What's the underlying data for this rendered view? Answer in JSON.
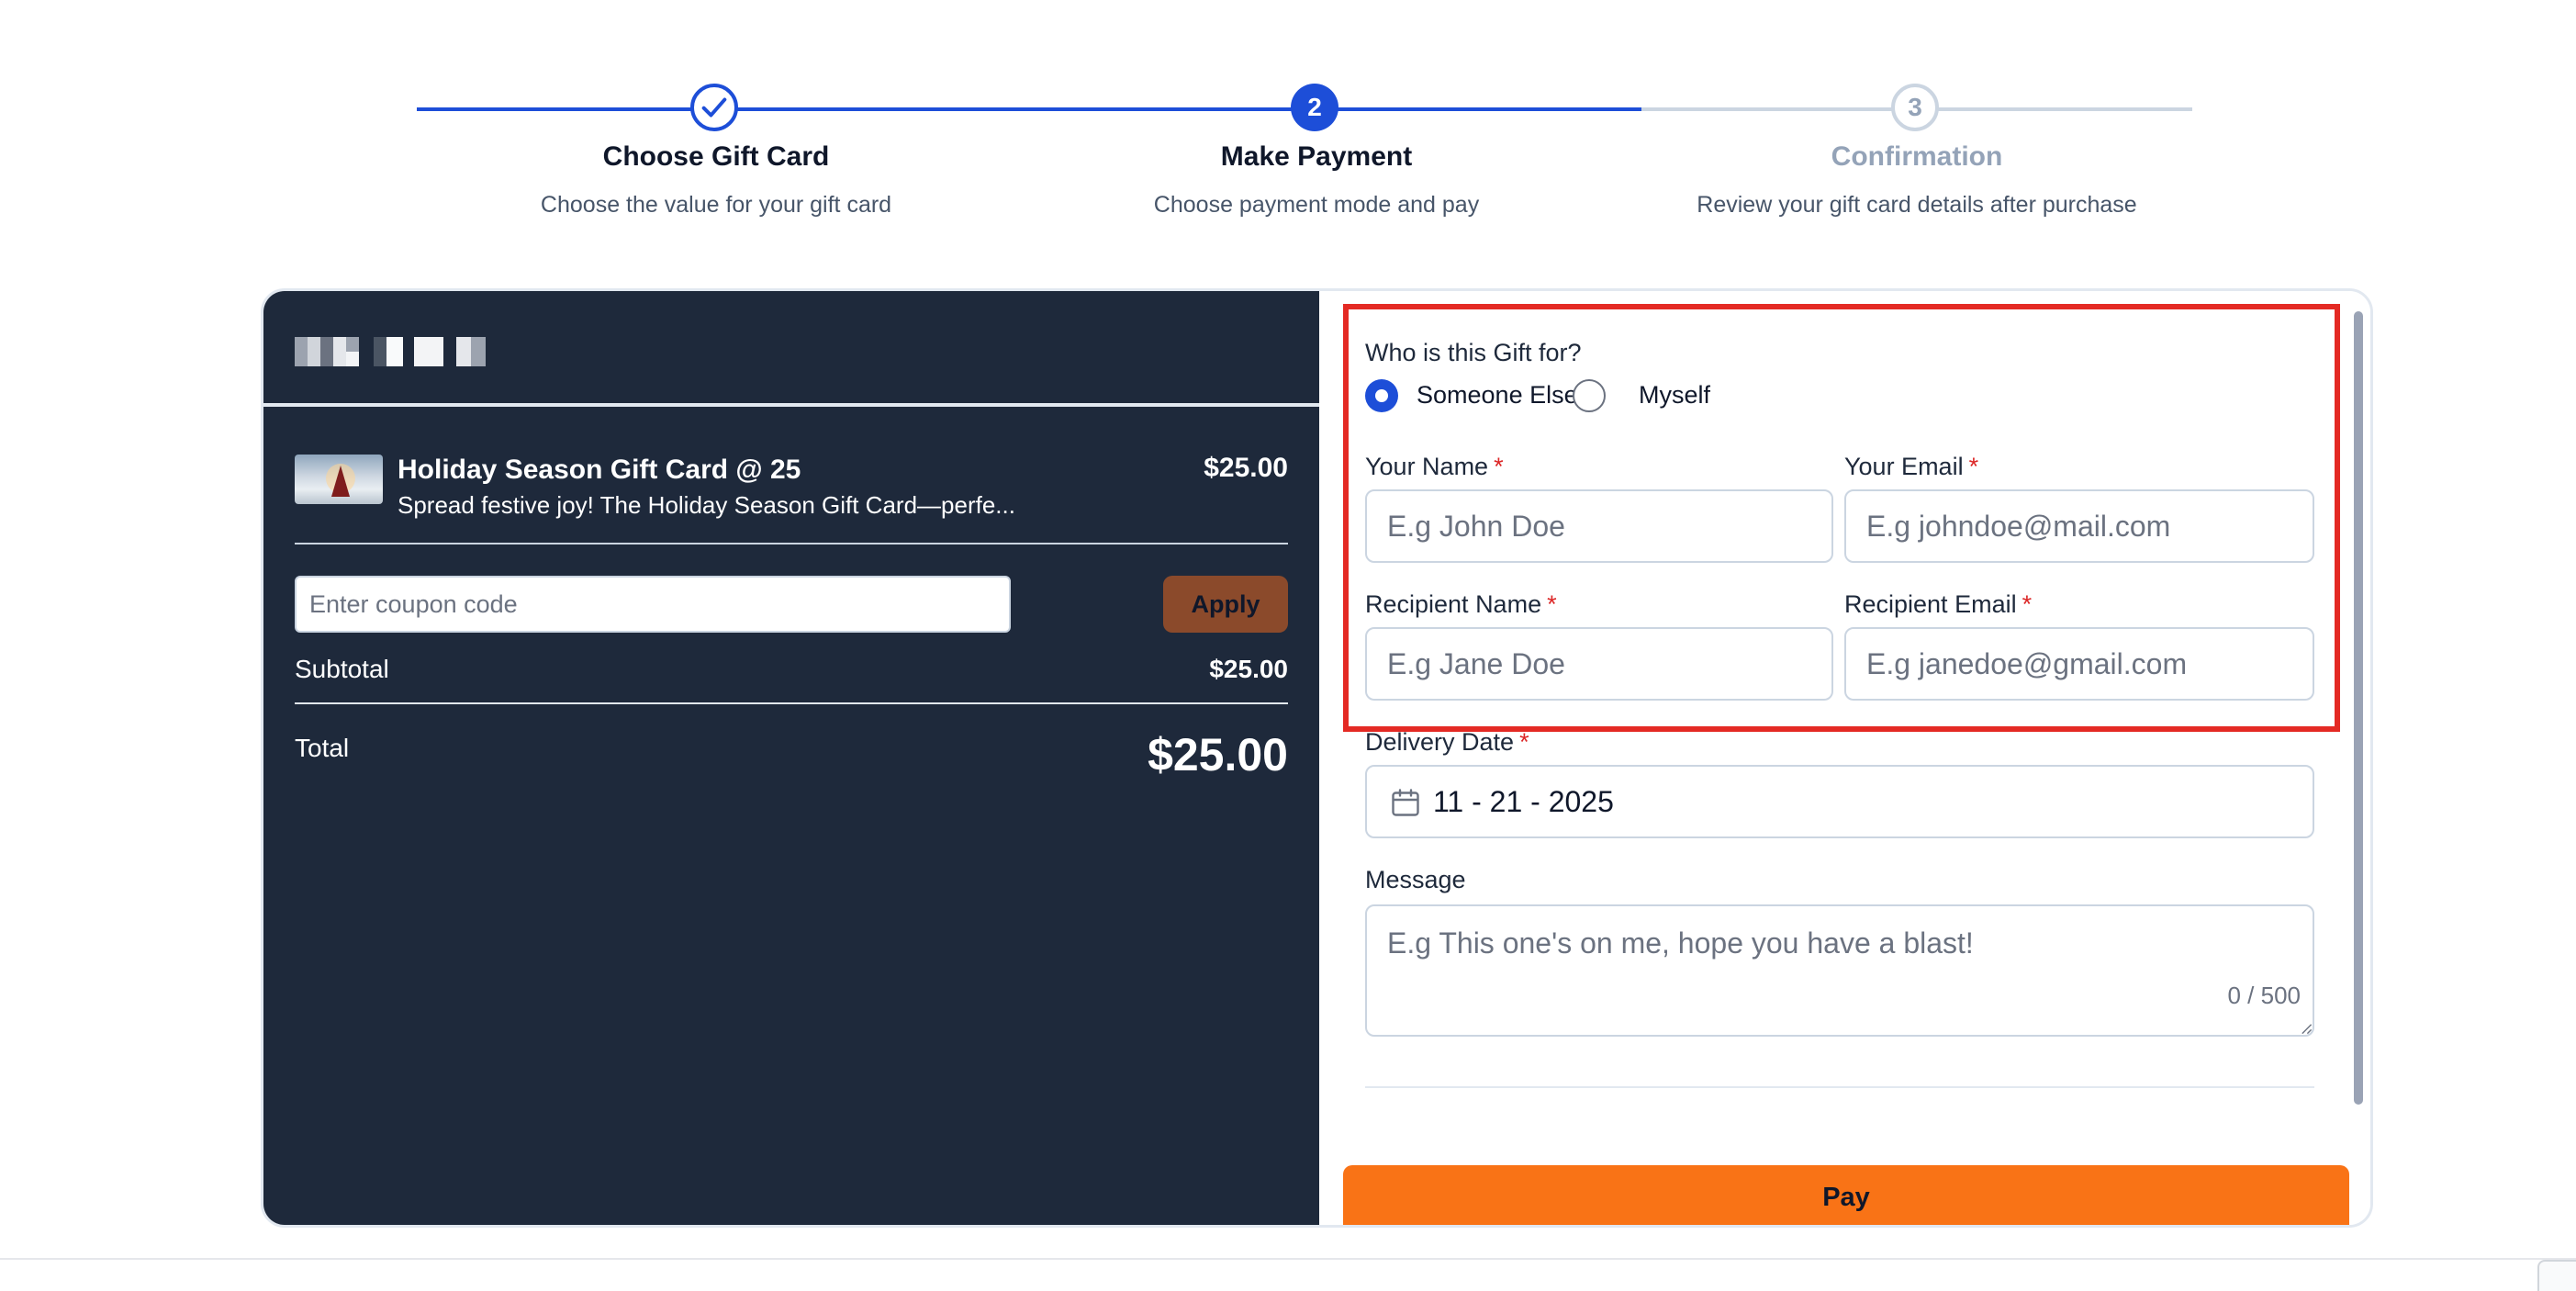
{
  "stepper": {
    "steps": [
      {
        "number": "✓",
        "title": "Choose Gift Card",
        "description": "Choose the value for your gift card",
        "state": "done"
      },
      {
        "number": "2",
        "title": "Make Payment",
        "description": "Choose payment mode and pay",
        "state": "active"
      },
      {
        "number": "3",
        "title": "Confirmation",
        "description": "Review your gift card details after purchase",
        "state": "pending"
      }
    ]
  },
  "order": {
    "item": {
      "title": "Holiday Season Gift Card @ 25",
      "description": "Spread festive joy! The Holiday Season Gift Card—perfe...",
      "price": "$25.00"
    },
    "coupon": {
      "placeholder": "Enter coupon code",
      "apply_label": "Apply"
    },
    "subtotal_label": "Subtotal",
    "subtotal_value": "$25.00",
    "total_label": "Total",
    "total_value": "$25.00"
  },
  "form": {
    "recipient_question": "Who is this Gift for?",
    "recipient_options": [
      "Someone Else",
      "Myself"
    ],
    "recipient_selected": "Someone Else",
    "your_name": {
      "label": "Your Name",
      "placeholder": "E.g John Doe"
    },
    "your_email": {
      "label": "Your Email",
      "placeholder": "E.g johndoe@mail.com"
    },
    "recipient_name": {
      "label": "Recipient Name",
      "placeholder": "E.g Jane Doe"
    },
    "recipient_email": {
      "label": "Recipient Email",
      "placeholder": "E.g janedoe@gmail.com"
    },
    "required_marker": "*",
    "delivery_date": {
      "label": "Delivery Date",
      "value": "11 - 21 - 2025"
    },
    "message": {
      "label": "Message",
      "placeholder": "E.g This one's on me, hope you have a blast!",
      "char_count": "0 / 500"
    },
    "pay_label": "Pay"
  },
  "colors": {
    "accent": "#1d4ed8",
    "panel_dark": "#1e293b",
    "apply_button": "#8b4a2b",
    "pay_button": "#f97316",
    "highlight": "#e42a24",
    "required": "#dc2626"
  }
}
